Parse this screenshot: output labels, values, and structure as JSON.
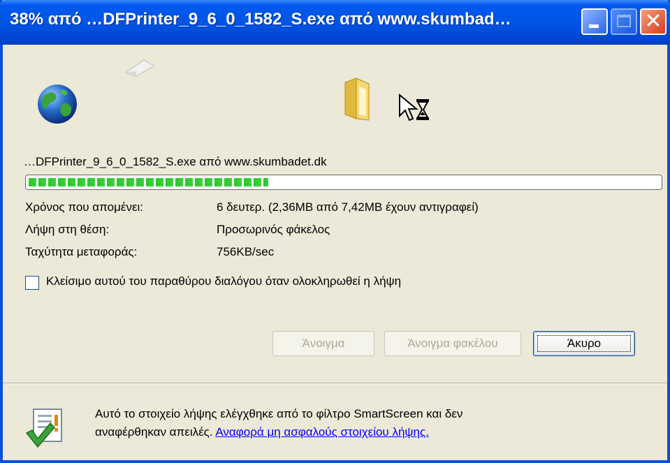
{
  "window": {
    "title": "38% από …DFPrinter_9_6_0_1582_S.exe από www.skumbad…"
  },
  "download": {
    "filename": "…DFPrinter_9_6_0_1582_S.exe από www.skumbadet.dk",
    "progress_percent": 38
  },
  "info": [
    {
      "label": "Χρόνος που απομένει:",
      "value": "6 δευτερ. (2,36MB από 7,42MB έχουν αντιγραφεί)"
    },
    {
      "label": "Λήψη στη θέση:",
      "value": "Προσωρινός φάκελος"
    },
    {
      "label": "Ταχύτητα μεταφοράς:",
      "value": "756KB/sec"
    }
  ],
  "close_checkbox": {
    "label": "Κλείσιμο αυτού του παραθύρου διαλόγου όταν ολοκληρωθεί η λήψη",
    "checked": false
  },
  "buttons": {
    "open": "Άνοιγμα",
    "open_folder": "Άνοιγμα φακέλου",
    "cancel": "Άκυρο"
  },
  "smartscreen": {
    "line1": "Αυτό το στοιχείο λήψης ελέγχθηκε από το φίλτρο SmartScreen και δεν",
    "line2": "αναφέρθηκαν απειλές.",
    "link": "Αναφορά μη ασφαλούς στοιχείου λήψης."
  },
  "icons": {
    "globe": "globe-icon",
    "flying_page": "document-icon",
    "folder": "folder-icon",
    "busy_cursor": "busy-cursor-icon",
    "smartscreen": "checklist-shield-icon"
  },
  "colors": {
    "titlebar": "#0055e5",
    "window_bg": "#ece9d8",
    "progress_fill": "#2fc32f",
    "link": "#0000ff"
  }
}
